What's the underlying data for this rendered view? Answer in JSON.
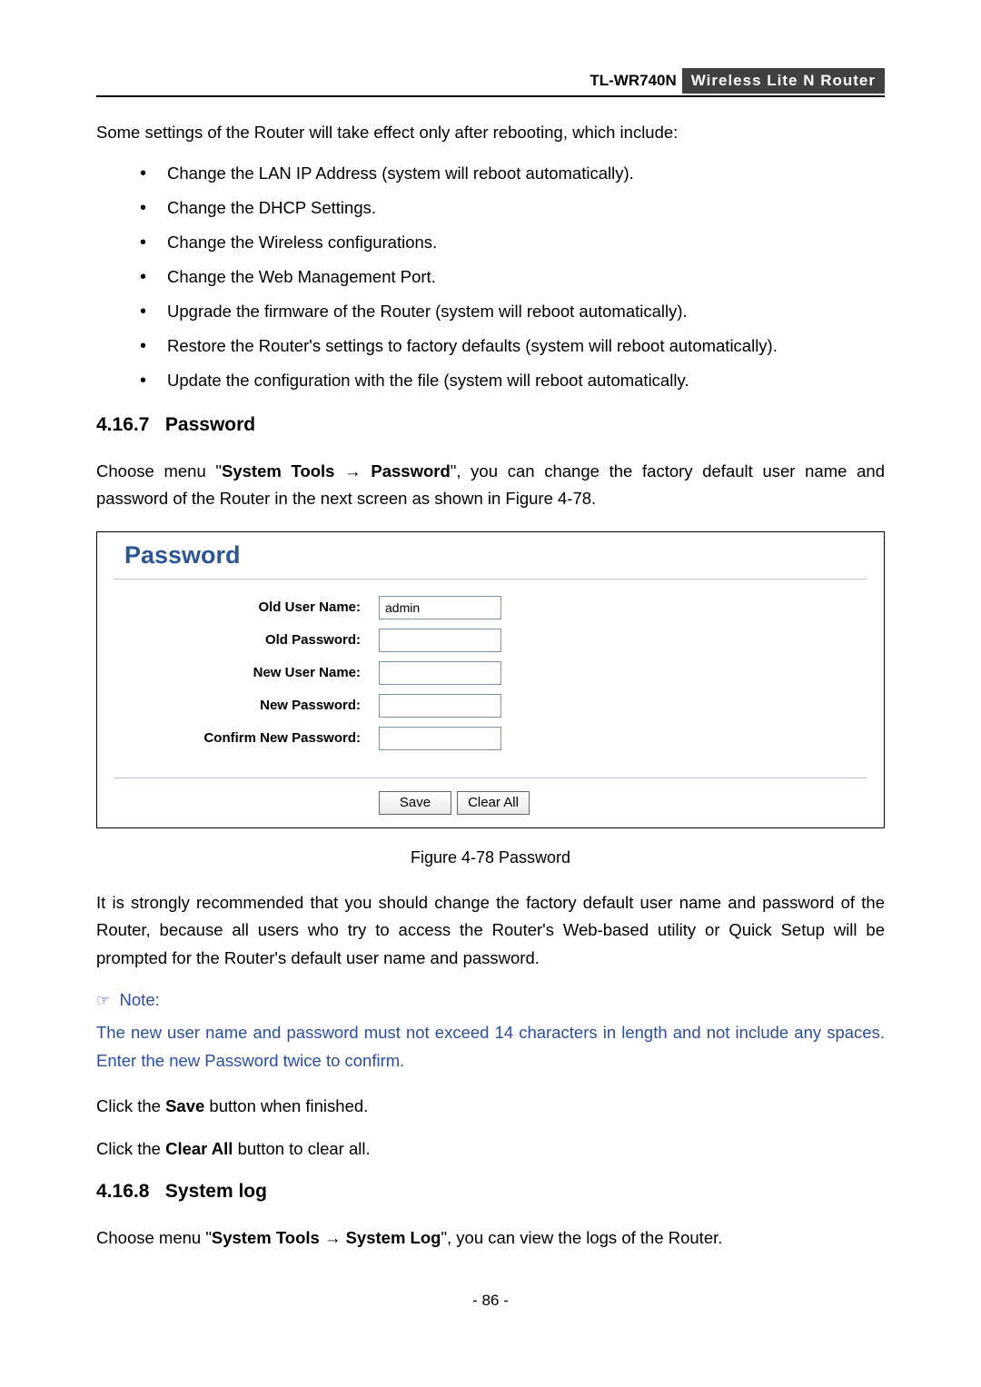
{
  "header": {
    "model": "TL-WR740N",
    "product": "Wireless  Lite  N  Router"
  },
  "intro": "Some settings of the Router will take effect only after rebooting, which include:",
  "bullets": [
    "Change the LAN IP Address (system will reboot automatically).",
    "Change the DHCP Settings.",
    "Change the Wireless configurations.",
    "Change the Web Management Port.",
    "Upgrade the firmware of the Router (system will reboot automatically).",
    "Restore the Router's settings to factory defaults (system will reboot automatically).",
    "Update the configuration with the file (system will reboot automatically."
  ],
  "sections": {
    "password": {
      "number": "4.16.7",
      "title": "Password",
      "lead_pre": "Choose menu \"",
      "lead_bold1": "System Tools",
      "lead_arrow": "  →  ",
      "lead_bold2": "Password",
      "lead_post": "\", you can change the factory default user name and password of the Router in the next screen as shown in Figure 4-78."
    },
    "syslog": {
      "number": "4.16.8",
      "title": "System log",
      "lead_pre": "Choose menu \"",
      "lead_bold1": "System Tools",
      "lead_arrow": "  →  ",
      "lead_bold2": "System Log",
      "lead_post": "\", you can view the logs of the Router."
    }
  },
  "figure": {
    "panel_title": "Password",
    "labels": {
      "old_user": "Old User Name:",
      "old_pass": "Old Password:",
      "new_user": "New User Name:",
      "new_pass": "New Password:",
      "confirm": "Confirm New Password:"
    },
    "values": {
      "old_user": "admin",
      "old_pass": "",
      "new_user": "",
      "new_pass": "",
      "confirm": ""
    },
    "buttons": {
      "save": "Save",
      "clear": "Clear All"
    },
    "caption": "Figure 4-78    Password"
  },
  "recommend": "It is strongly recommended that you should change the factory default user name and password of the Router, because all users who try to access the Router's Web-based utility or Quick Setup will be prompted for the Router's default user name and password.",
  "note": {
    "label": "Note:",
    "body": "The new user name and password must not exceed 14 characters in length and not include any spaces. Enter the new Password twice to confirm."
  },
  "click_save_pre": "Click the ",
  "click_save_bold": "Save",
  "click_save_post": " button when finished.",
  "click_clear_pre": "Click the ",
  "click_clear_bold": "Clear All",
  "click_clear_post": " button to clear all.",
  "page_number": "- 86 -"
}
